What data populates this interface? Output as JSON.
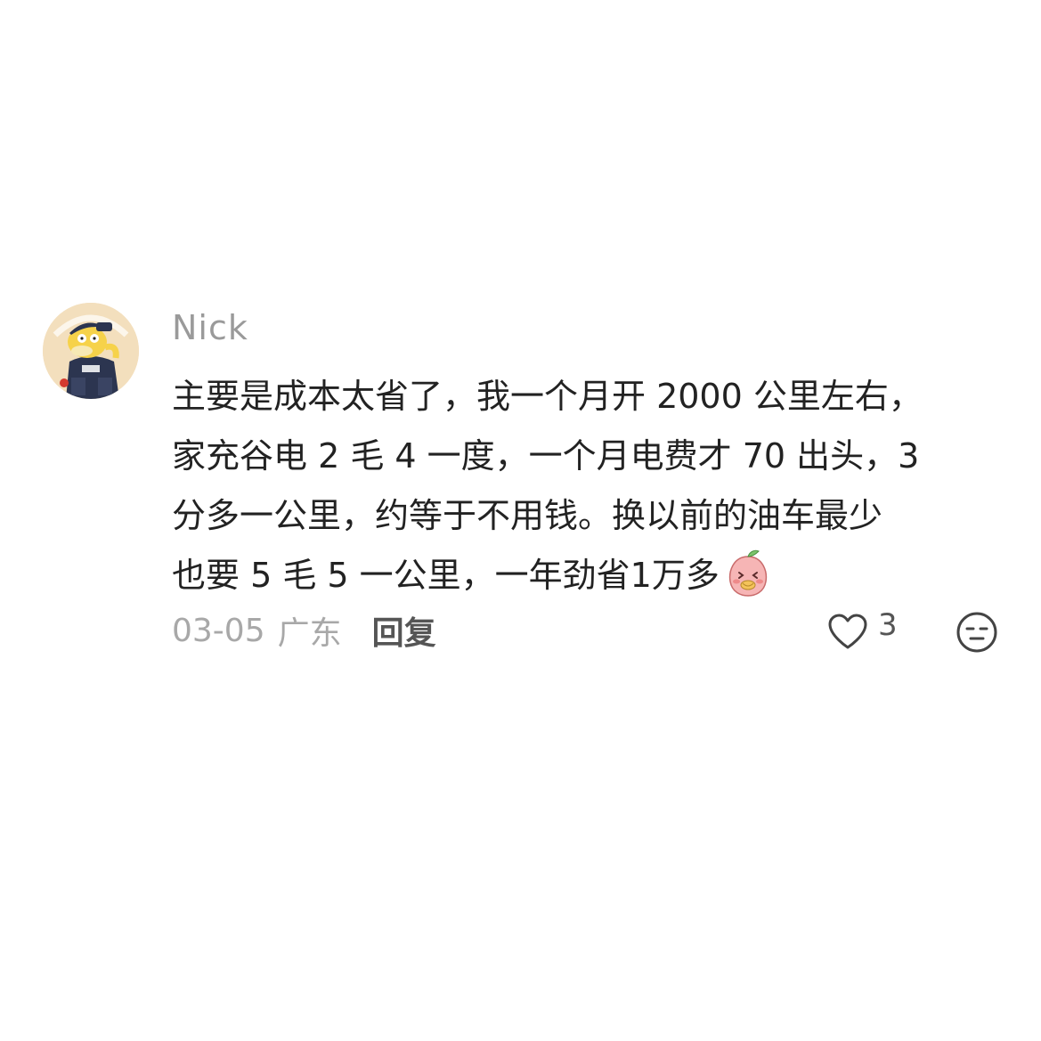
{
  "comment": {
    "username": "Nick",
    "avatar_icon": "psyduck-avatar-icon",
    "body_lines": [
      "主要是成本太省了，我一个月开 2000 公里左右，",
      "家充谷电 2 毛 4 一度，一个月电费才 70 出头，3",
      "分多一公里，约等于不用钱。换以前的油车最少",
      "也要 5 毛 5 一公里，一年劲省1万多"
    ],
    "trailing_emoji": "peach-eating-emoji-icon",
    "meta": {
      "date": "03-05",
      "location": "广东",
      "reply_label": "回复"
    },
    "like": {
      "icon": "heart-outline-icon",
      "count": "3"
    },
    "reaction_icon": "unamused-face-icon"
  },
  "colors": {
    "background": "#ffffff",
    "text_primary": "#222222",
    "text_secondary": "#9a9a9a",
    "avatar_bg": "#f3dfbd"
  }
}
